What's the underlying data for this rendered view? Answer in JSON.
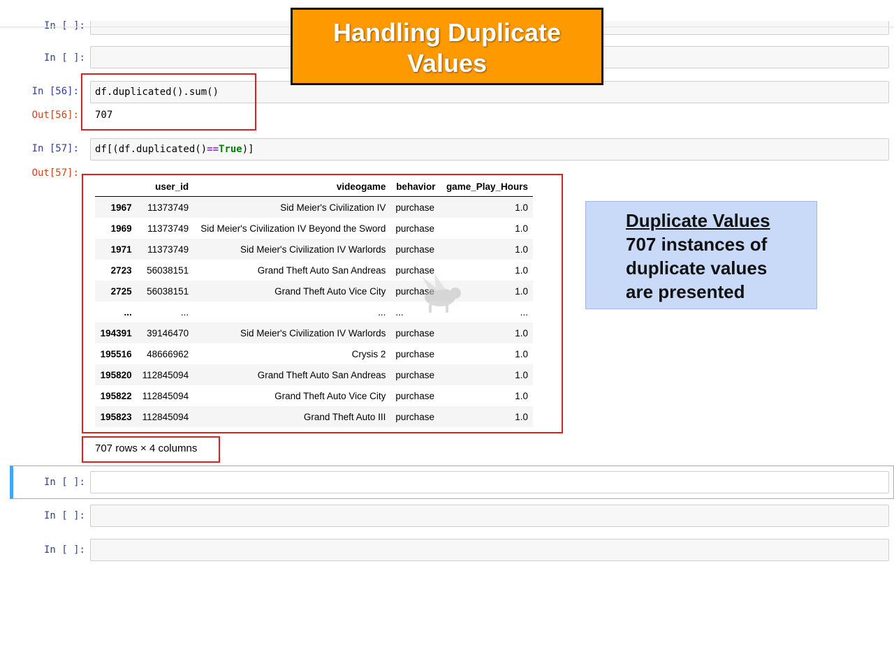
{
  "title_banner": {
    "line1": "Handling Duplicate",
    "line2": "Values"
  },
  "cells": {
    "c1": {
      "prompt": "In [ ]:"
    },
    "c2": {
      "prompt": "In [ ]:"
    },
    "c3": {
      "prompt": "In [56]:",
      "code": "df.duplicated().sum()",
      "out_prompt": "Out[56]:",
      "output": "707"
    },
    "c4": {
      "prompt": "In [57]:",
      "code_pre": "df[(df.duplicated()",
      "code_op": "==",
      "code_kw": "True",
      "code_post": ")]",
      "out_prompt": "Out[57]:"
    },
    "c5": {
      "prompt": "In [ ]:"
    },
    "c6": {
      "prompt": "In [ ]:"
    },
    "c7": {
      "prompt": "In [ ]:"
    }
  },
  "dataframe": {
    "columns": [
      "",
      "user_id",
      "videogame",
      "behavior",
      "game_Play_Hours"
    ],
    "rows": [
      {
        "index": "1967",
        "user_id": "11373749",
        "videogame": "Sid Meier's Civilization IV",
        "behavior": "purchase",
        "hours": "1.0"
      },
      {
        "index": "1969",
        "user_id": "11373749",
        "videogame": "Sid Meier's Civilization IV Beyond the Sword",
        "behavior": "purchase",
        "hours": "1.0"
      },
      {
        "index": "1971",
        "user_id": "11373749",
        "videogame": "Sid Meier's Civilization IV Warlords",
        "behavior": "purchase",
        "hours": "1.0"
      },
      {
        "index": "2723",
        "user_id": "56038151",
        "videogame": "Grand Theft Auto San Andreas",
        "behavior": "purchase",
        "hours": "1.0"
      },
      {
        "index": "2725",
        "user_id": "56038151",
        "videogame": "Grand Theft Auto Vice City",
        "behavior": "purchase",
        "hours": "1.0"
      },
      {
        "index": "...",
        "user_id": "...",
        "videogame": "...",
        "behavior": "...",
        "hours": "..."
      },
      {
        "index": "194391",
        "user_id": "39146470",
        "videogame": "Sid Meier's Civilization IV Warlords",
        "behavior": "purchase",
        "hours": "1.0"
      },
      {
        "index": "195516",
        "user_id": "48666962",
        "videogame": "Crysis 2",
        "behavior": "purchase",
        "hours": "1.0"
      },
      {
        "index": "195820",
        "user_id": "112845094",
        "videogame": "Grand Theft Auto San Andreas",
        "behavior": "purchase",
        "hours": "1.0"
      },
      {
        "index": "195822",
        "user_id": "112845094",
        "videogame": "Grand Theft Auto Vice City",
        "behavior": "purchase",
        "hours": "1.0"
      },
      {
        "index": "195823",
        "user_id": "112845094",
        "videogame": "Grand Theft Auto III",
        "behavior": "purchase",
        "hours": "1.0"
      }
    ],
    "shape": "707 rows × 4 columns"
  },
  "note": {
    "title": "Duplicate Values",
    "line1": "707 instances of",
    "line2": "duplicate values",
    "line3": "are presented"
  },
  "colors": {
    "banner": "#ff9900",
    "highlight_box": "#e01f1f",
    "note_bg": "#c9daf8",
    "in_prompt": "#303f9f",
    "out_prompt": "#d84315"
  }
}
